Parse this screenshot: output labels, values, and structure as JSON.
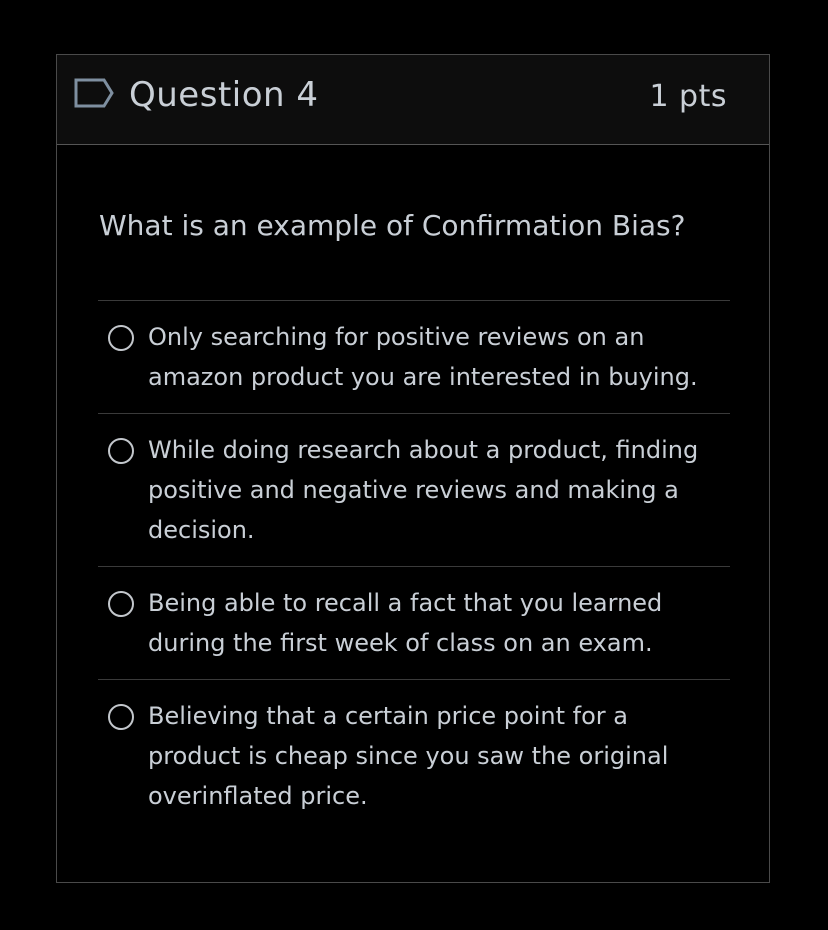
{
  "question": {
    "title": "Question 4",
    "points": "1 pts",
    "prompt": "What is an example of Confirmation Bias?",
    "flag_icon": "bookmark-flag-icon",
    "answers": [
      {
        "lines": [
          "Only searching for positive reviews on an",
          "amazon product you are interested in buying."
        ]
      },
      {
        "lines": [
          "While doing research about a product, finding",
          "positive and negative reviews and making a",
          "decision."
        ]
      },
      {
        "lines": [
          "Being able to recall a fact that you learned",
          "during the first week of class on an exam."
        ]
      },
      {
        "lines": [
          "Believing that a certain price point for a",
          "product is cheap since you saw the original",
          "overinflated price."
        ]
      }
    ]
  },
  "colors": {
    "background": "#000000",
    "header_background": "#0d0d0d",
    "text": "#c9cfd6",
    "border": "#4a4a4a",
    "flag_outline": "#7e8fa0"
  }
}
